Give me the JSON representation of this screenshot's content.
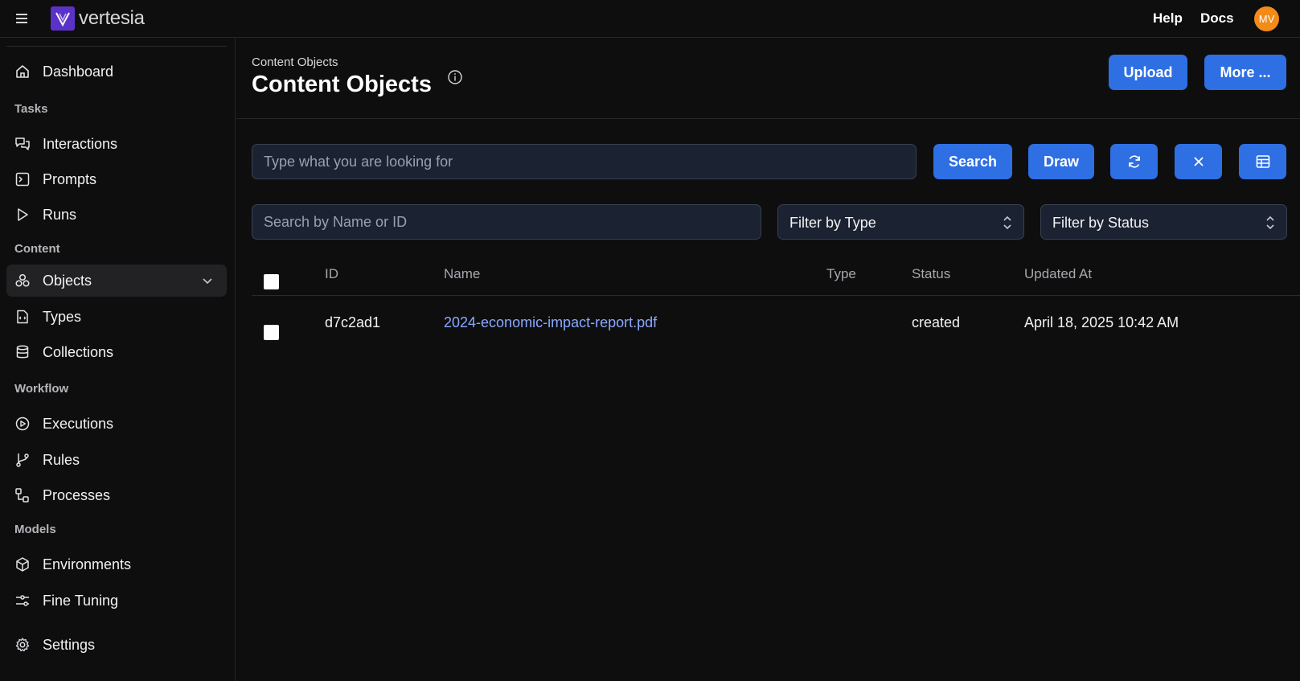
{
  "app": {
    "logo_text": "vertesia"
  },
  "topbar": {
    "help_label": "Help",
    "docs_label": "Docs",
    "avatar_initials": "MV",
    "avatar_color": "#f28b17"
  },
  "sidebar": {
    "dashboard": "Dashboard",
    "sections": {
      "tasks": "Tasks",
      "content": "Content",
      "workflow": "Workflow",
      "models": "Models"
    },
    "items": {
      "interactions": "Interactions",
      "prompts": "Prompts",
      "runs": "Runs",
      "objects": "Objects",
      "types": "Types",
      "collections": "Collections",
      "executions": "Executions",
      "rules": "Rules",
      "processes": "Processes",
      "environments": "Environments",
      "fine_tuning": "Fine Tuning",
      "settings": "Settings"
    }
  },
  "main": {
    "breadcrumb": "Content Objects",
    "title": "Content Objects",
    "upload_label": "Upload",
    "more_label": "More ...",
    "semantic_search": {
      "placeholder": "Type what you are looking for"
    },
    "search_label": "Search",
    "draw_label": "Draw",
    "name_search": {
      "placeholder": "Search by Name or ID"
    },
    "filter_type": "Filter by Type",
    "filter_status": "Filter by Status",
    "table": {
      "headers": {
        "id": "ID",
        "name": "Name",
        "type": "Type",
        "status": "Status",
        "updated_at": "Updated At"
      },
      "rows": [
        {
          "id": "d7c2ad1",
          "name": "2024-economic-impact-report.pdf",
          "type": "",
          "status": "created",
          "updated_at": "April 18, 2025 10:42 AM"
        }
      ]
    }
  },
  "colors": {
    "accent": "#2f6fe4",
    "link": "#8aa8ff",
    "background": "#0e0e0f",
    "brand_logo": "#5a32c8"
  }
}
